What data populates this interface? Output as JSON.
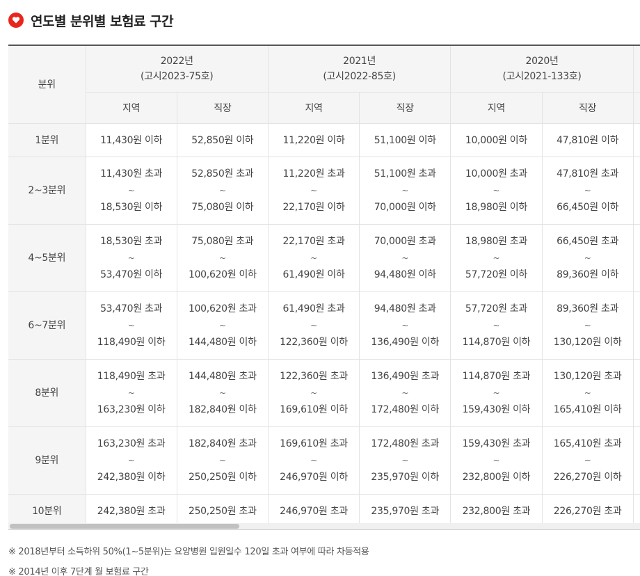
{
  "title": "연도별 분위별 보험료 구간",
  "colors": {
    "accent": "#e8261c",
    "header_bg": "#f5f5f5",
    "border": "#e3e3e3"
  },
  "icons": {
    "title": "heart-badge-icon"
  },
  "table": {
    "quintile_header": "분위",
    "years": [
      {
        "year": "2022년",
        "notice": "(고시2023-75호)"
      },
      {
        "year": "2021년",
        "notice": "(고시2022-85호)"
      },
      {
        "year": "2020년",
        "notice": "(고시2021-133호)"
      }
    ],
    "sub_headers": [
      "지역",
      "직장",
      "지역",
      "직장",
      "지역",
      "직장"
    ],
    "rows": [
      {
        "label": "1분위",
        "cells": [
          {
            "from": "11,430원 이하"
          },
          {
            "from": "52,850원 이하"
          },
          {
            "from": "11,220원 이하"
          },
          {
            "from": "51,100원 이하"
          },
          {
            "from": "10,000원 이하"
          },
          {
            "from": "47,810원 이하"
          }
        ]
      },
      {
        "label": "2~3분위",
        "cells": [
          {
            "from": "11,430원 초과",
            "sep": "~",
            "to": "18,530원 이하"
          },
          {
            "from": "52,850원 초과",
            "sep": "~",
            "to": "75,080원 이하"
          },
          {
            "from": "11,220원 초과",
            "sep": "~",
            "to": "22,170원 이하"
          },
          {
            "from": "51,100원 초과",
            "sep": "~",
            "to": "70,000원 이하"
          },
          {
            "from": "10,000원 초과",
            "sep": "~",
            "to": "18,980원 이하"
          },
          {
            "from": "47,810원 초과",
            "sep": "~",
            "to": "66,450원 이하"
          }
        ]
      },
      {
        "label": "4~5분위",
        "cells": [
          {
            "from": "18,530원 초과",
            "sep": "~",
            "to": "53,470원 이하"
          },
          {
            "from": "75,080원 초과",
            "sep": "~",
            "to": "100,620원 이하"
          },
          {
            "from": "22,170원 초과",
            "sep": "~",
            "to": "61,490원 이하"
          },
          {
            "from": "70,000원 초과",
            "sep": "~",
            "to": "94,480원 이하"
          },
          {
            "from": "18,980원 초과",
            "sep": "~",
            "to": "57,720원 이하"
          },
          {
            "from": "66,450원 초과",
            "sep": "~",
            "to": "89,360원 이하"
          }
        ]
      },
      {
        "label": "6~7분위",
        "cells": [
          {
            "from": "53,470원 초과",
            "sep": "~",
            "to": "118,490원 이하"
          },
          {
            "from": "100,620원 초과",
            "sep": "~",
            "to": "144,480원 이하"
          },
          {
            "from": "61,490원 초과",
            "sep": "~",
            "to": "122,360원 이하"
          },
          {
            "from": "94,480원 초과",
            "sep": "~",
            "to": "136,490원 이하"
          },
          {
            "from": "57,720원 초과",
            "sep": "~",
            "to": "114,870원 이하"
          },
          {
            "from": "89,360원 초과",
            "sep": "~",
            "to": "130,120원 이하"
          }
        ]
      },
      {
        "label": "8분위",
        "cells": [
          {
            "from": "118,490원 초과",
            "sep": "~",
            "to": "163,230원 이하"
          },
          {
            "from": "144,480원 초과",
            "sep": "~",
            "to": "182,840원 이하"
          },
          {
            "from": "122,360원 초과",
            "sep": "~",
            "to": "169,610원 이하"
          },
          {
            "from": "136,490원 초과",
            "sep": "~",
            "to": "172,480원 이하"
          },
          {
            "from": "114,870원 초과",
            "sep": "~",
            "to": "159,430원 이하"
          },
          {
            "from": "130,120원 초과",
            "sep": "~",
            "to": "165,410원 이하"
          }
        ]
      },
      {
        "label": "9분위",
        "cells": [
          {
            "from": "163,230원 초과",
            "sep": "~",
            "to": "242,380원 이하"
          },
          {
            "from": "182,840원 초과",
            "sep": "~",
            "to": "250,250원 이하"
          },
          {
            "from": "169,610원 초과",
            "sep": "~",
            "to": "246,970원 이하"
          },
          {
            "from": "172,480원 초과",
            "sep": "~",
            "to": "235,970원 이하"
          },
          {
            "from": "159,430원 초과",
            "sep": "~",
            "to": "232,800원 이하"
          },
          {
            "from": "165,410원 초과",
            "sep": "~",
            "to": "226,270원 이하"
          }
        ]
      },
      {
        "label": "10분위",
        "cells": [
          {
            "from": "242,380원 초과"
          },
          {
            "from": "250,250원 초과"
          },
          {
            "from": "246,970원 초과"
          },
          {
            "from": "235,970원 초과"
          },
          {
            "from": "232,800원 초과"
          },
          {
            "from": "226,270원 초과"
          }
        ]
      }
    ]
  },
  "notes": [
    "※ 2018년부터 소득하위 50%(1~5분위)는 요양병원 입원일수 120일 초과 여부에 따라 차등적용",
    "※ 2014년 이후 7단계 월 보험료 구간"
  ]
}
